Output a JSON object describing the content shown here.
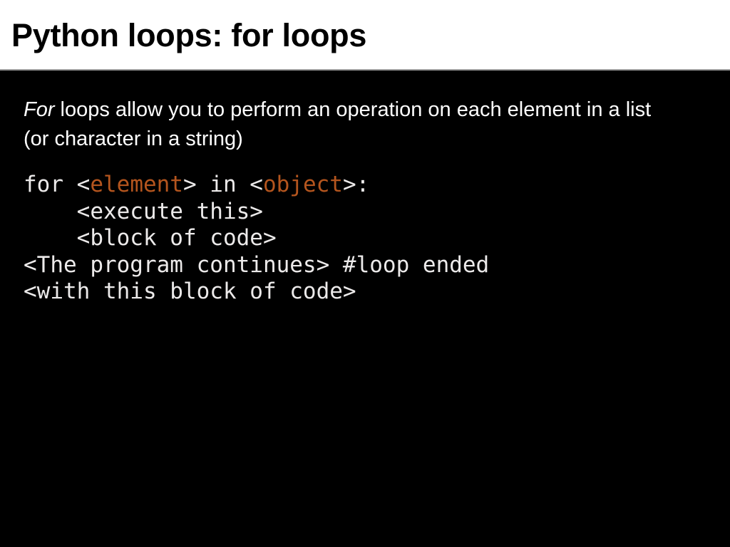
{
  "slide": {
    "title": "Python loops: for loops",
    "background_color": "#000000",
    "title_band_color": "#ffffff",
    "title_text_color": "#000000",
    "body_text_color": "#ffffff",
    "code_text_color": "#eceaea",
    "accent_color": "#b4551e"
  },
  "body": {
    "paragraph": {
      "emphasis": "For",
      "rest": " loops allow you to perform an operation on each element in a list (or character in a string)"
    }
  },
  "code": {
    "lines": [
      {
        "segments": [
          {
            "text": "for <",
            "style": "plain"
          },
          {
            "text": "element",
            "style": "var"
          },
          {
            "text": "> in <",
            "style": "plain"
          },
          {
            "text": "object",
            "style": "var"
          },
          {
            "text": ">:",
            "style": "plain"
          }
        ],
        "plain_text": "for <element> in <object>:"
      },
      {
        "segments": [
          {
            "text": "    <execute this>",
            "style": "plain"
          }
        ],
        "plain_text": "    <execute this>"
      },
      {
        "segments": [
          {
            "text": "    <block of code>",
            "style": "plain"
          }
        ],
        "plain_text": "    <block of code>"
      },
      {
        "segments": [
          {
            "text": "<The program continues> #loop ended",
            "style": "plain"
          }
        ],
        "plain_text": "<The program continues> #loop ended"
      },
      {
        "segments": [
          {
            "text": "<with this block of code>",
            "style": "plain"
          }
        ],
        "plain_text": "<with this block of code>"
      }
    ]
  }
}
